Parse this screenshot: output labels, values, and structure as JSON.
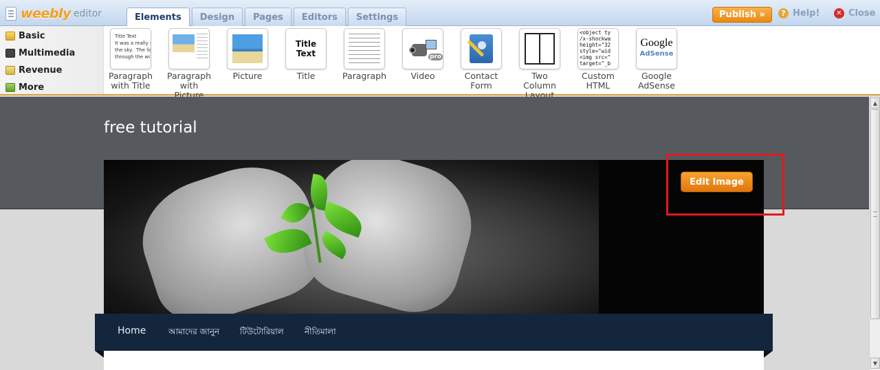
{
  "topbar": {
    "brand": "weebly",
    "brand_sub": "editor",
    "tabs": [
      "Elements",
      "Design",
      "Pages",
      "Editors",
      "Settings"
    ],
    "active_tab": "Elements",
    "publish_label": "Publish »",
    "help_label": "Help!",
    "close_label": "Close"
  },
  "sidebar": {
    "categories": [
      "Basic",
      "Multimedia",
      "Revenue",
      "More"
    ]
  },
  "elements": [
    {
      "label_line1": "Paragraph",
      "label_line2": "with Title",
      "preview": "Title Text\nIt was a really s\nthe sky.  The lig\nthrough the wi"
    },
    {
      "label_line1": "Paragraph",
      "label_line2": "with Picture"
    },
    {
      "label_line1": "Picture",
      "label_line2": ""
    },
    {
      "label_line1": "Title",
      "label_line2": "",
      "preview": "Title Text"
    },
    {
      "label_line1": "Paragraph",
      "label_line2": ""
    },
    {
      "label_line1": "Video",
      "label_line2": "",
      "badge": "pro"
    },
    {
      "label_line1": "Contact",
      "label_line2": "Form"
    },
    {
      "label_line1": "Two Column",
      "label_line2": "Layout"
    },
    {
      "label_line1": "Custom",
      "label_line2": "HTML",
      "preview": "<object ty\n/x-shockwa\nheight=\"32\nstyle=\"wid\n<img src=\"\ntarget=\"_b"
    },
    {
      "label_line1": "Google",
      "label_line2": "AdSense",
      "preview_line1": "Google",
      "preview_line2": "AdSense"
    }
  ],
  "site": {
    "title": "free tutorial",
    "edit_image_label": "Edit Image",
    "nav": [
      "Home",
      "আমাদের জানুন",
      "টিউটোরিয়াল",
      "নীতিমালা"
    ]
  },
  "colors": {
    "accent_orange": "#e98911",
    "nav_bg": "#14263b",
    "header_bg": "#56595d",
    "highlight_red": "#e21b1b"
  },
  "icons": {
    "help": "question-circle-icon",
    "close": "x-circle-icon",
    "scroll_up": "arrow-up-icon",
    "scroll_down": "arrow-down-icon"
  }
}
